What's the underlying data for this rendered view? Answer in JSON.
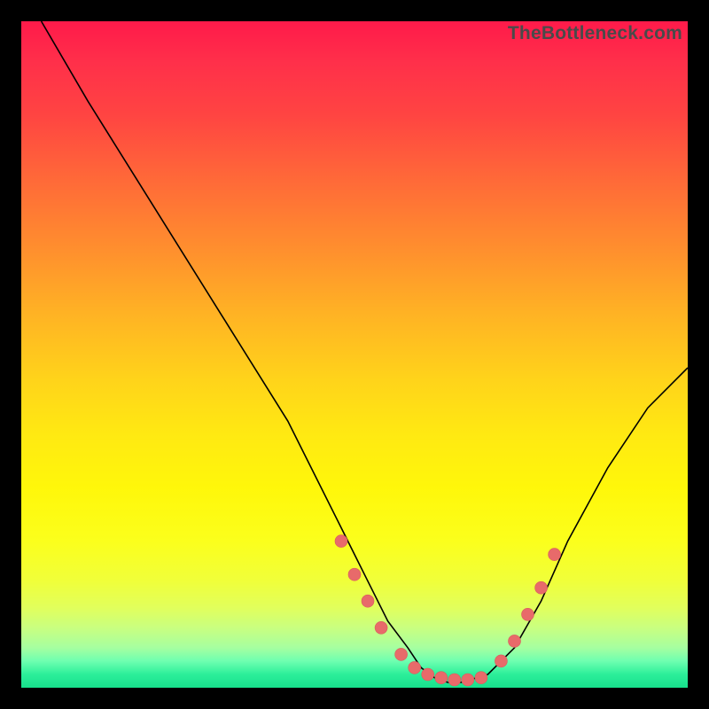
{
  "watermark": "TheBottleneck.com",
  "chart_data": {
    "type": "line",
    "title": "",
    "xlabel": "",
    "ylabel": "",
    "xlim": [
      0,
      100
    ],
    "ylim": [
      0,
      100
    ],
    "series": [
      {
        "name": "curve",
        "x": [
          3,
          10,
          20,
          30,
          40,
          48,
          52,
          55,
          58,
          60,
          62,
          64,
          66,
          70,
          74,
          78,
          82,
          88,
          94,
          100
        ],
        "y": [
          100,
          88,
          72,
          56,
          40,
          24,
          16,
          10,
          6,
          3,
          1.5,
          0.8,
          0.8,
          2,
          6,
          13,
          22,
          33,
          42,
          48
        ]
      },
      {
        "name": "dots",
        "x": [
          48,
          50,
          52,
          54,
          57,
          59,
          61,
          63,
          65,
          67,
          69,
          72,
          74,
          76,
          78,
          80
        ],
        "y": [
          22,
          17,
          13,
          9,
          5,
          3,
          2,
          1.5,
          1.2,
          1.2,
          1.5,
          4,
          7,
          11,
          15,
          20
        ]
      }
    ],
    "grid": false,
    "legend": false
  }
}
